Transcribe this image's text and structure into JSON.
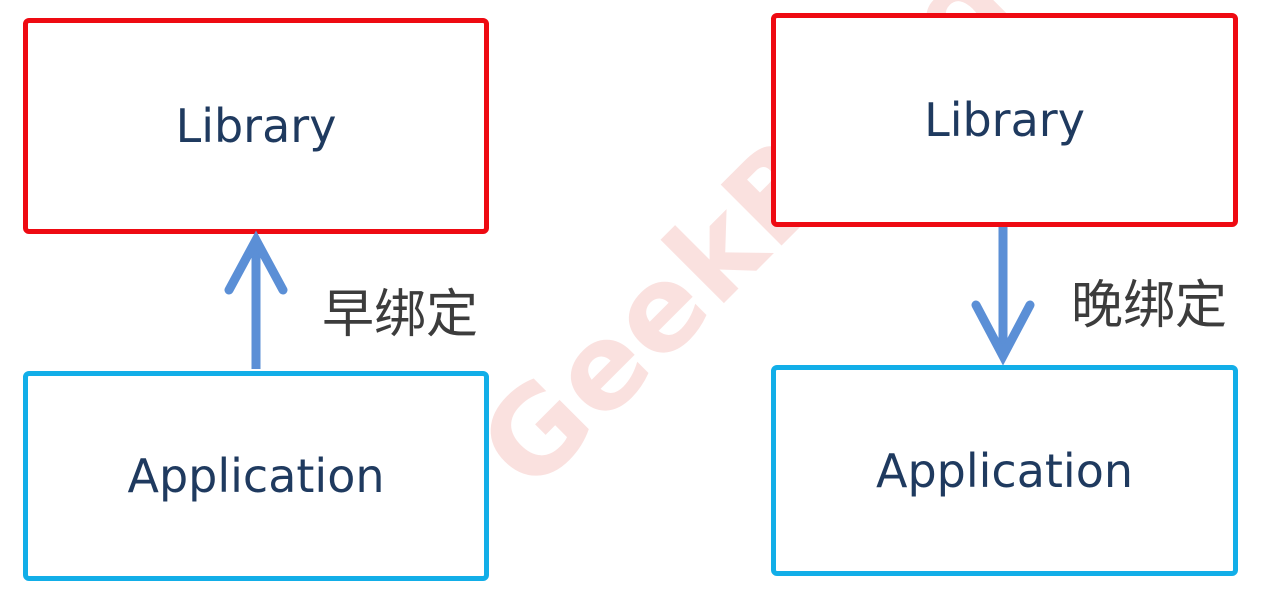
{
  "watermark": "GeekBand",
  "left": {
    "library_label": "Library",
    "application_label": "Application",
    "binding_label": "早绑定"
  },
  "right": {
    "library_label": "Library",
    "application_label": "Application",
    "binding_label": "晚绑定"
  },
  "colors": {
    "library_border": "#ee0a12",
    "application_border": "#12aee8",
    "arrow": "#5b8fd6",
    "text": "#1f3a5f"
  }
}
